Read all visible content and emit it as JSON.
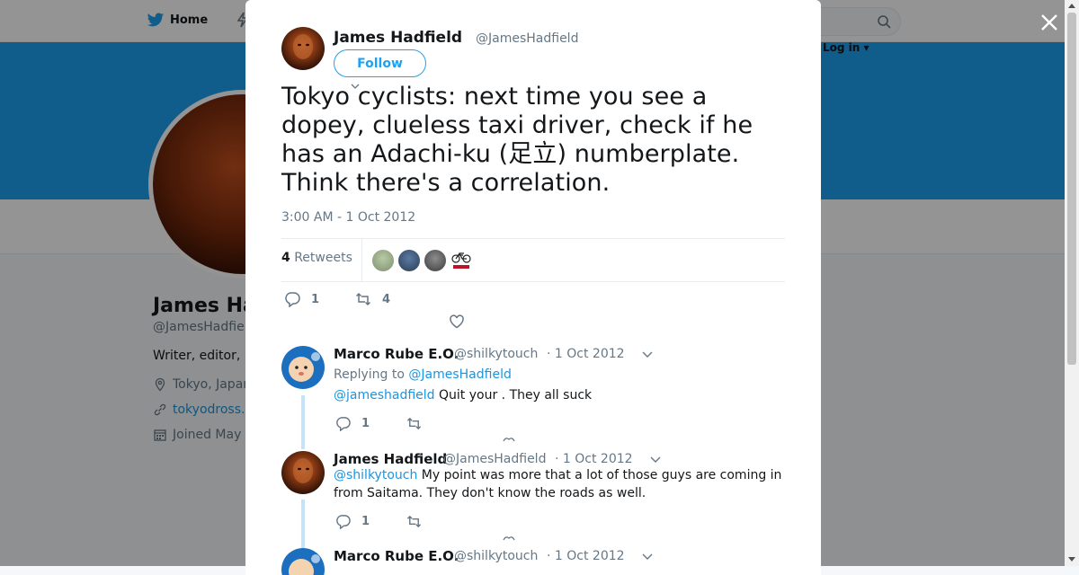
{
  "nav": {
    "home_label": "Home",
    "login_label": "Log in ▾"
  },
  "profile": {
    "name": "James Ha",
    "handle": "@JamesHadfie",
    "bio": "Writer, editor, (",
    "location": "Tokyo, Japan",
    "website": "tokyodross.",
    "joined": "Joined May"
  },
  "main_tweet": {
    "author_name": "James Hadfield",
    "author_handle": "@JamesHadfield",
    "follow_label": "Follow",
    "text": "Tokyo cyclists: next time you see a dopey, clueless taxi driver, check if he has an Adachi-ku (足立) numberplate. Think there's a correlation.",
    "timestamp": "3:00 AM - 1 Oct 2012",
    "retweet_count": "4",
    "retweets_label": "Retweets",
    "reply_count": "1",
    "retweet_action_count": "4"
  },
  "replies": [
    {
      "author_name": "Marco Rube E.O.",
      "author_handle": "@shilkytouch",
      "date": "· 1 Oct 2012",
      "replying_prefix": "Replying to",
      "replying_to": "@JamesHadfield",
      "mention": "@jameshadfield",
      "text": "Quit your . They all suck",
      "reply_count": "1"
    },
    {
      "author_name": "James Hadfield",
      "author_handle": "@JamesHadfield",
      "date": "· 1 Oct 2012",
      "mention": "@shilkytouch",
      "text": "My point was more that a lot of those guys are coming in from Saitama. They don't know the roads as well.",
      "reply_count": "1"
    },
    {
      "author_name": "Marco Rube E.O.",
      "author_handle": "@shilkytouch",
      "date": "· 1 Oct 2012"
    }
  ],
  "colors": {
    "accent": "#1da1f2",
    "link": "#1b95e0",
    "muted": "#657786",
    "banner": "#1da1f2"
  },
  "icons": [
    "twitter-bird-icon",
    "search-icon",
    "close-icon",
    "reply-icon",
    "retweet-icon",
    "heart-icon",
    "chevron-down-icon",
    "location-icon",
    "link-icon",
    "calendar-icon"
  ]
}
